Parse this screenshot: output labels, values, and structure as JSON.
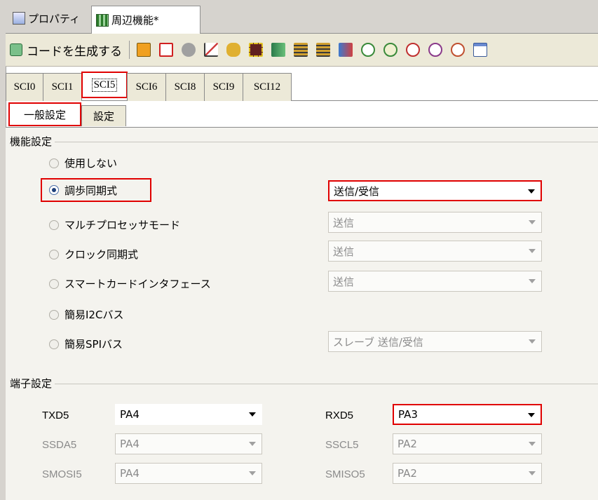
{
  "top_tabs": {
    "properties": "プロパティ",
    "peripheral": "周辺機能*"
  },
  "toolbar": {
    "generate_code": "コードを生成する",
    "icons": [
      "hierarchy-icon",
      "red-box-icon",
      "component-icon",
      "chart-icon",
      "tool-icon",
      "chip-icon",
      "pin-icon",
      "group-a-icon",
      "group-b-icon",
      "transfer-icon",
      "clock-icon-1",
      "clock-icon-2",
      "clock-icon-3",
      "clock-icon-4",
      "clock-icon-5",
      "window-icon"
    ]
  },
  "sci_tabs": [
    "SCI0",
    "SCI1",
    "SCI5",
    "SCI6",
    "SCI8",
    "SCI9",
    "SCI12"
  ],
  "sci_active": "SCI5",
  "sub_tabs": {
    "general": "一般設定",
    "settings": "設定"
  },
  "function_settings": {
    "title": "機能設定",
    "options": {
      "unused": "使用しない",
      "async": "調歩同期式",
      "multiproc": "マルチプロセッサモード",
      "clock_sync": "クロック同期式",
      "smartcard": "スマートカードインタフェース",
      "i2c": "簡易I2Cバス",
      "spi": "簡易SPIバス"
    },
    "selected": "async",
    "combos": {
      "async": "送信/受信",
      "multiproc": "送信",
      "clock_sync": "送信",
      "smartcard": "送信",
      "spi": "スレーブ 送信/受信"
    }
  },
  "pin_settings": {
    "title": "端子設定",
    "txd_label": "TXD5",
    "txd_value": "PA4",
    "rxd_label": "RXD5",
    "rxd_value": "PA3",
    "ssda_label": "SSDA5",
    "ssda_value": "PA4",
    "sscl_label": "SSCL5",
    "sscl_value": "PA2",
    "smosi_label": "SMOSI5",
    "smosi_value": "PA4",
    "smiso_label": "SMISO5",
    "smiso_value": "PA2"
  },
  "colors": {
    "highlight": "#e00000",
    "disabled_text": "#8a8a8a",
    "panel_bg": "#f4f3ee"
  }
}
